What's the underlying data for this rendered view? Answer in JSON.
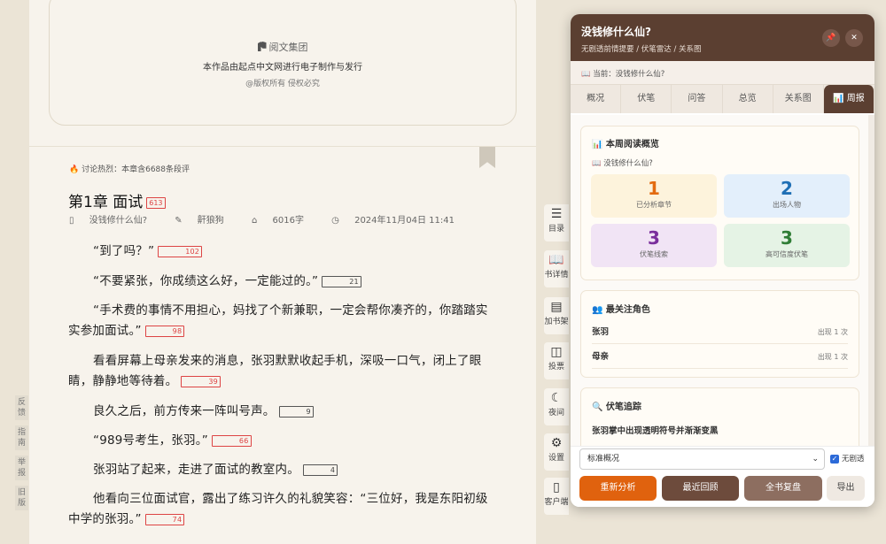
{
  "book": {
    "brand": "阅文集团",
    "copyright_line": "本作品由起点中文网进行电子制作与发行",
    "rights": "@版权所有 侵权必究"
  },
  "chapter": {
    "hot_text": "讨论热烈：本章含6688条段评",
    "title": "第1章 面试",
    "title_badge": "613",
    "book_name": "没钱修什么仙?",
    "author": "鼾狼狗",
    "word_count": "6016字",
    "date": "2024年11月04日 11:41",
    "paragraphs": [
      {
        "text": "“到了吗？”",
        "badge": "102",
        "badge_style": "red"
      },
      {
        "text": "“不要紧张，你成绩这么好，一定能过的。”",
        "badge": "21",
        "badge_style": "gray"
      },
      {
        "text": "“手术费的事情不用担心，妈找了个新兼职，一定会帮你凑齐的，你踏踏实实参加面试。”",
        "badge": "98",
        "badge_style": "red"
      },
      {
        "text": "看看屏幕上母亲发来的消息，张羽默默收起手机，深吸一口气，闭上了眼睛，静静地等待着。",
        "badge": "39",
        "badge_style": "red"
      },
      {
        "text": "良久之后，前方传来一阵叫号声。",
        "badge": "9",
        "badge_style": "gray"
      },
      {
        "text": "“989号考生，张羽。”",
        "badge": "66",
        "badge_style": "red"
      },
      {
        "text": "张羽站了起来，走进了面试的教室内。",
        "badge": "4",
        "badge_style": "gray"
      },
      {
        "text": "他看向三位面试官，露出了练习许久的礼貌笑容：“三位好，我是东阳初级中学的张羽。”",
        "badge": "74",
        "badge_style": "red"
      }
    ]
  },
  "left_sidebar": [
    "反馈",
    "指南",
    "举报",
    "旧版"
  ],
  "right_tools": [
    {
      "icon": "☰",
      "label": "目录"
    },
    {
      "icon": "📖",
      "label": "书详情"
    },
    {
      "icon": "▤",
      "label": "加书架"
    },
    {
      "icon": "◫",
      "label": "投票"
    },
    {
      "icon": "☾",
      "label": "夜间"
    },
    {
      "icon": "⚙",
      "label": "设置"
    },
    {
      "icon": "▯",
      "label": "客户端"
    }
  ],
  "panel": {
    "title": "没钱修什么仙?",
    "subtitle": "无剧透前情提要 / 伏笔雷达 / 关系图",
    "current": "📖 当前：没钱修什么仙?",
    "tabs": [
      "概况",
      "伏笔",
      "问答",
      "总览",
      "关系图",
      "📊 周报"
    ],
    "active_tab": 5,
    "weekly": {
      "title": "📊 本周阅读概览",
      "book": "📖 没钱修什么仙?",
      "stats": [
        {
          "value": "1",
          "label": "已分析章节",
          "color": "#e36b10",
          "bg": "#fdf3dc"
        },
        {
          "value": "2",
          "label": "出场人物",
          "color": "#1f6fb5",
          "bg": "#e3effb"
        },
        {
          "value": "3",
          "label": "伏笔线索",
          "color": "#7a2e9c",
          "bg": "#f1e4f5"
        },
        {
          "value": "3",
          "label": "高可信度伏笔",
          "color": "#2f7d35",
          "bg": "#e5f3e5"
        }
      ]
    },
    "top_chars": {
      "title": "👥 最关注角色",
      "items": [
        {
          "name": "张羽",
          "count": "出现 1 次"
        },
        {
          "name": "母亲",
          "count": "出现 1 次"
        }
      ]
    },
    "foreshadow": {
      "title": "🔍 伏笔追踪",
      "first": "张羽掌中出现透明符号并渐渐变黑"
    },
    "footer": {
      "mode": "标准概况",
      "spoiler_label": "无剧透",
      "buttons": [
        "重新分析",
        "最近回顾",
        "全书复盘",
        "导出"
      ]
    }
  },
  "colors": {
    "panel_header": "#5b3f31",
    "btn_reanalyze": "#e0620e",
    "btn_recent": "#6d4b3c",
    "btn_review": "#8d6e60"
  }
}
